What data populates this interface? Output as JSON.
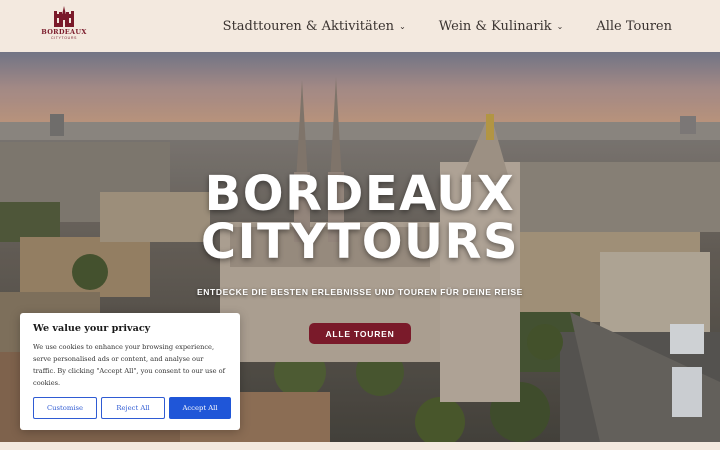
{
  "header": {
    "logo": {
      "name": "BORDEAUX",
      "tagline": "CITYTOURS"
    },
    "nav": [
      {
        "label": "Stadttouren & Aktivitäten",
        "has_dropdown": true
      },
      {
        "label": "Wein & Kulinarik",
        "has_dropdown": true
      },
      {
        "label": "Alle Touren",
        "has_dropdown": false
      }
    ],
    "dropdown_icon": "chevron-down-icon"
  },
  "hero": {
    "title_line1": "BORDEAUX",
    "title_line2": "CITYTOURS",
    "subtitle": "ENTDECKE DIE BESTEN ERLEBNISSE UND TOUREN FÜR DEINE REISE",
    "cta_label": "ALLE TOUREN"
  },
  "cookie_banner": {
    "title": "We value your privacy",
    "text": "We use cookies to enhance your browsing experience, serve personalised ads or content, and analyse our traffic. By clicking \"Accept All\", you consent to our use of cookies.",
    "buttons": {
      "customise": "Customise",
      "reject": "Reject All",
      "accept": "Accept All"
    }
  },
  "colors": {
    "header_bg": "#f3e9df",
    "brand": "#7a1a2a",
    "accept_blue": "#1f56d8",
    "outline_blue": "#2f5bd3"
  }
}
